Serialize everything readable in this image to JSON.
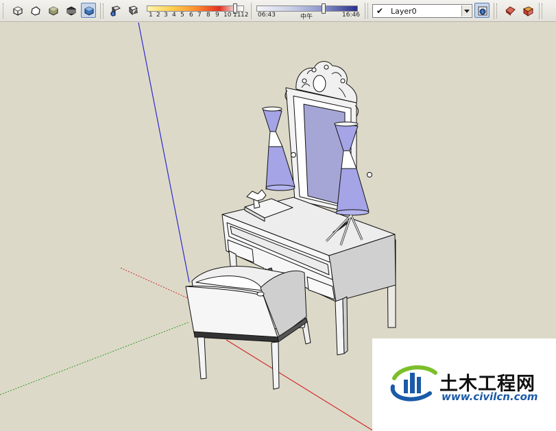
{
  "toolbar": {
    "shadow_month_labels": [
      "1",
      "2",
      "3",
      "4",
      "5",
      "6",
      "7",
      "8",
      "9",
      "10",
      "11",
      "12"
    ],
    "time_start": "06:43",
    "time_mid": "中午",
    "time_end": "16:46",
    "layer": {
      "checkmark": "✔",
      "name": "Layer0"
    }
  },
  "watermark": {
    "name": "土木工程网",
    "url": "www.civilcn.com"
  },
  "colors": {
    "viewport_bg": "#ddd9c8",
    "axis_blue": "#2a2ad0",
    "axis_red": "#d02a2a",
    "axis_green": "#2a9a2a",
    "mirror_glass": "#a6a6d6",
    "lamp_shade": "#a4a4e6",
    "logo_blue": "#1a5aa8",
    "logo_green": "#7bbf2a"
  }
}
